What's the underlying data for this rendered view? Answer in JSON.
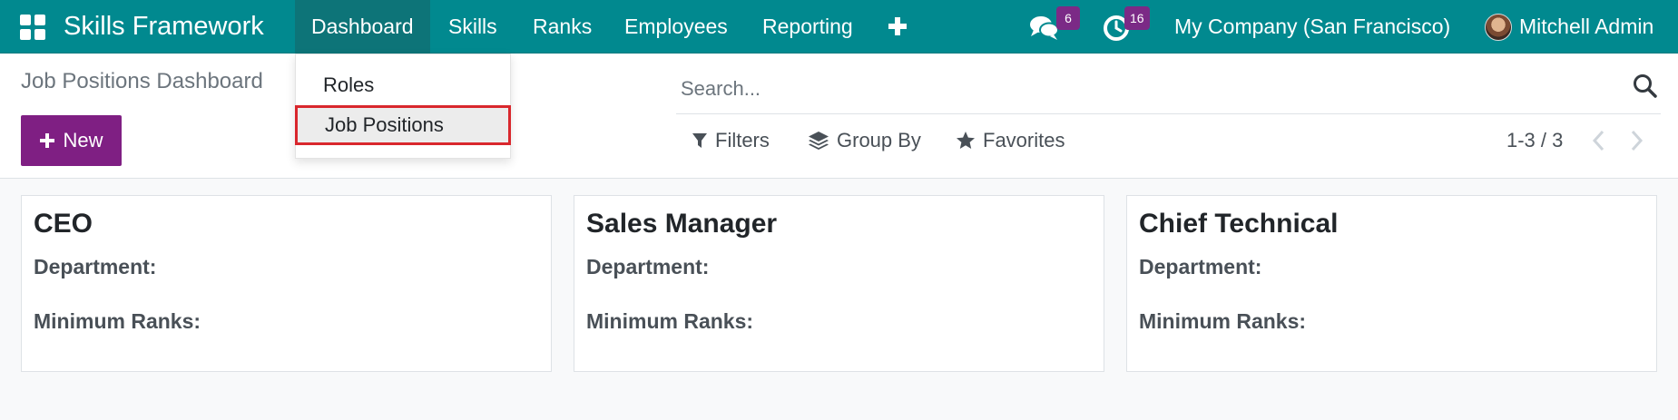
{
  "navbar": {
    "brand": "Skills Framework",
    "menu": [
      {
        "label": "Dashboard"
      },
      {
        "label": "Skills"
      },
      {
        "label": "Ranks"
      },
      {
        "label": "Employees"
      },
      {
        "label": "Reporting"
      }
    ],
    "messages_badge": "6",
    "activities_badge": "16",
    "company": "My Company (San Francisco)",
    "user": "Mitchell Admin"
  },
  "dropdown": {
    "items": [
      {
        "label": "Roles"
      },
      {
        "label": "Job Positions"
      }
    ]
  },
  "control_panel": {
    "breadcrumb": "Job Positions Dashboard",
    "new_label": "New",
    "search_placeholder": "Search...",
    "filters_label": "Filters",
    "group_by_label": "Group By",
    "favorites_label": "Favorites",
    "pager": "1-3 / 3"
  },
  "cards": [
    {
      "title": "CEO",
      "department_label": "Department:",
      "ranks_label": "Minimum Ranks:"
    },
    {
      "title": "Sales Manager",
      "department_label": "Department:",
      "ranks_label": "Minimum Ranks:"
    },
    {
      "title": "Chief Technical",
      "department_label": "Department:",
      "ranks_label": "Minimum Ranks:"
    }
  ],
  "colors": {
    "navbar": "#01898f",
    "primary_button": "#7f1f83",
    "badge": "#7b2a86",
    "highlight_border": "#d9272d"
  }
}
